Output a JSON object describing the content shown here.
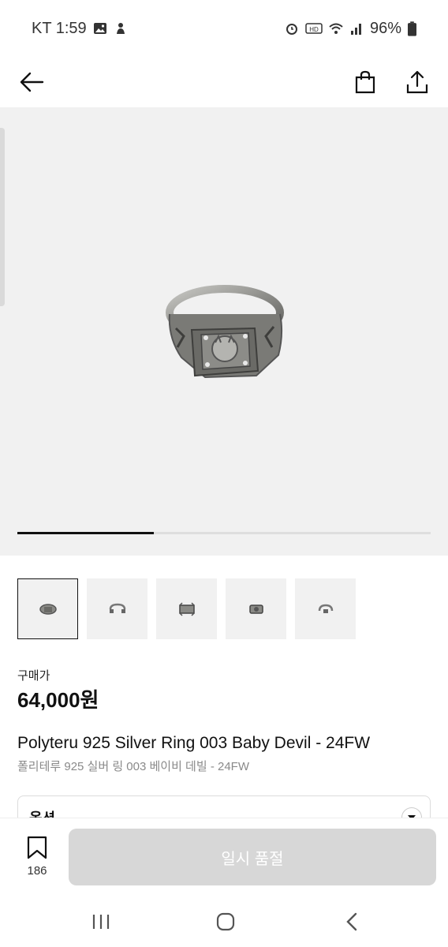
{
  "status_bar": {
    "carrier_time": "KT 1:59",
    "battery": "96%"
  },
  "icons": {
    "back": "arrow-left-icon",
    "cart": "shopping-bag-icon",
    "share": "share-upload-icon",
    "bookmark": "bookmark-icon",
    "dropdown": "chevron-down-icon"
  },
  "gallery": {
    "image_count": 5,
    "current_index": 1,
    "progress_fraction": 0.33
  },
  "thumbnails": [
    {
      "label": "ring-front"
    },
    {
      "label": "ring-side"
    },
    {
      "label": "ring-top"
    },
    {
      "label": "ring-angle"
    },
    {
      "label": "ring-open"
    }
  ],
  "product": {
    "price_label": "구매가",
    "price": "64,000원",
    "title_en": "Polyteru 925 Silver Ring 003 Baby Devil - 24FW",
    "title_ko": "폴리테루 925 실버 링 003 베이비 데빌 - 24FW"
  },
  "option": {
    "label": "옵션"
  },
  "bottom": {
    "bookmark_count": "186",
    "cta_label": "일시 품절"
  },
  "colors": {
    "gallery_bg": "#f1f1f1",
    "cta_disabled": "#d7d7d7"
  }
}
